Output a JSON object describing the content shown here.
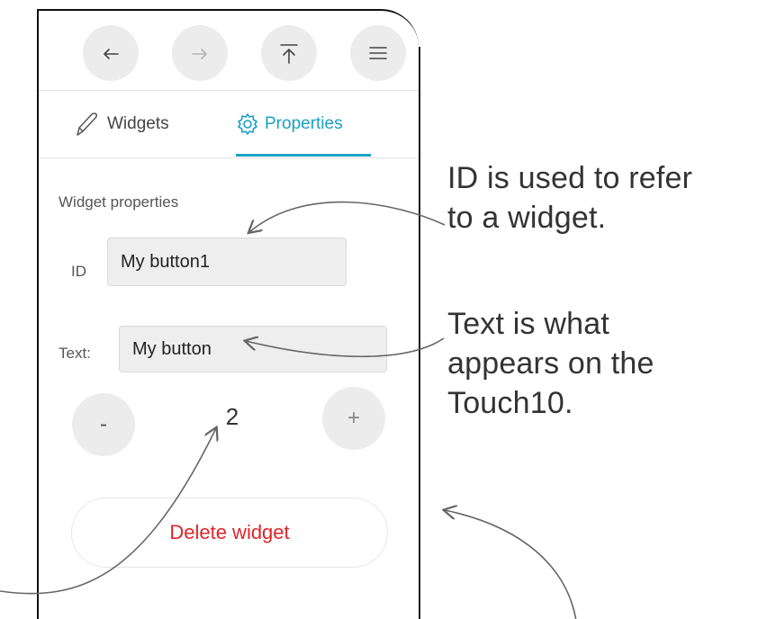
{
  "toolbar": {
    "buttons": [
      {
        "name": "undo",
        "icon": "undo-arrow-icon",
        "enabled": true
      },
      {
        "name": "redo",
        "icon": "redo-arrow-icon",
        "enabled": false
      },
      {
        "name": "upload",
        "icon": "upload-to-top-icon",
        "enabled": true
      },
      {
        "name": "menu",
        "icon": "hamburger-menu-icon",
        "enabled": true
      }
    ]
  },
  "tabs": {
    "widgets_label": "Widgets",
    "properties_label": "Properties",
    "active": "properties",
    "accent_color": "#1aa1c4"
  },
  "properties": {
    "section_title": "Widget properties",
    "id_label": "ID",
    "id_value": "My button1",
    "text_label": "Text:",
    "text_value": "My button",
    "stepper": {
      "minus_label": "-",
      "value": "2",
      "plus_label": "+"
    },
    "delete_label": "Delete widget",
    "delete_color": "#e0242a"
  },
  "annotations": {
    "id_note": [
      "ID is used to refer",
      "to a widget."
    ],
    "text_note": [
      "Text is what",
      "appears on the",
      "Touch10."
    ]
  }
}
